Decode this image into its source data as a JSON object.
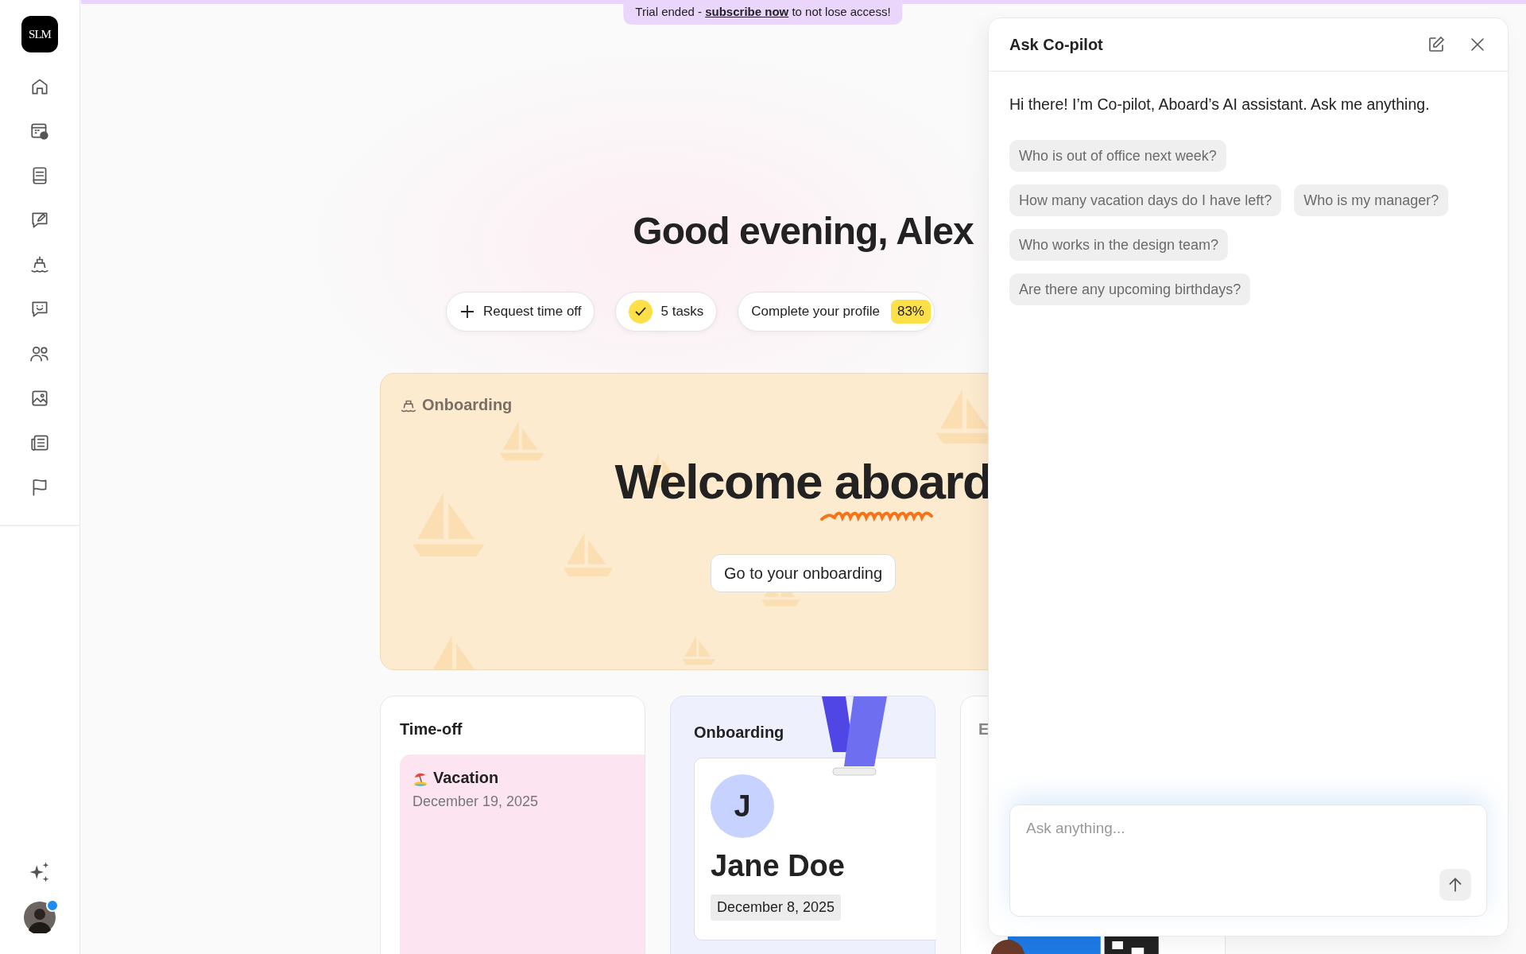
{
  "banner": {
    "before": "Trial ended - ",
    "link": "subscribe now",
    "after": " to not lose access!"
  },
  "logo": "SLM",
  "greeting": "Good evening, Alex",
  "actions": [
    {
      "kind": "request",
      "label": "Request time off"
    },
    {
      "kind": "tasks",
      "label": "5 tasks"
    },
    {
      "kind": "profile",
      "label": "Complete your profile",
      "badge": "83%"
    }
  ],
  "onboarding_banner": {
    "label": "Onboarding",
    "title": "Welcome aboard",
    "button": "Go to your onboarding"
  },
  "cards": [
    {
      "kind": "timeoff",
      "title": "Time-off",
      "entry_title": "Vacation",
      "entry_date": "December 19, 2025"
    },
    {
      "kind": "onboarding",
      "title": "Onboarding",
      "initial": "J",
      "name": "Jane Doe",
      "date": "December 8, 2025"
    },
    {
      "kind": "other",
      "title": "E"
    }
  ],
  "copilot": {
    "title": "Ask Co-pilot",
    "greeting": "Hi there! I’m Co-pilot, Aboard’s AI assistant. Ask me anything.",
    "suggestion_rows": [
      [
        "Who is out of office next week?"
      ],
      [
        "How many vacation days do I have left?",
        "Who is my manager?"
      ],
      [
        "Who works in the design team?"
      ],
      [
        "Are there any upcoming birthdays?"
      ]
    ],
    "placeholder": "Ask anything..."
  }
}
